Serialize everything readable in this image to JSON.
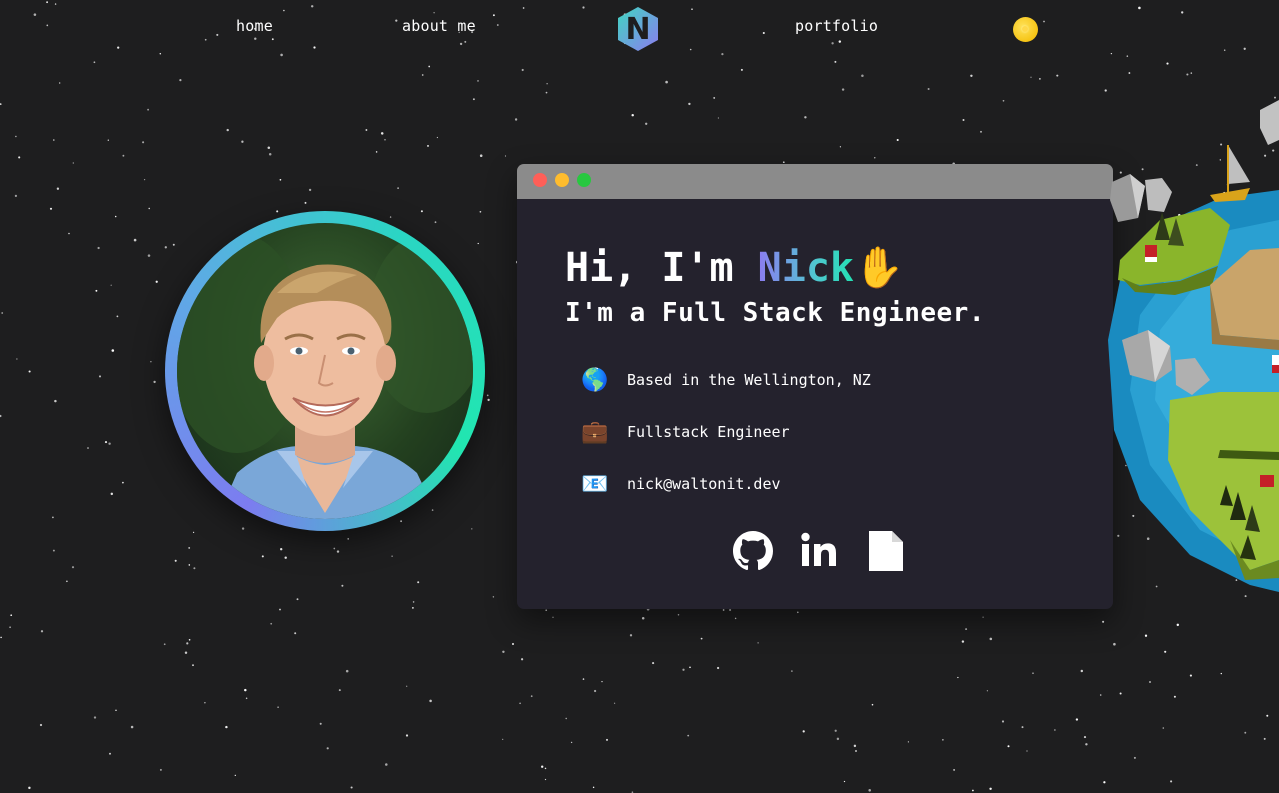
{
  "nav": {
    "home": "home",
    "about": "about me",
    "logo_letter": "N",
    "portfolio": "portfolio",
    "theme_toggle_icon": "sun-icon"
  },
  "hero": {
    "greeting_prefix": "Hi, I'm ",
    "name": "Nick",
    "wave_emoji": "✋",
    "subtitle": "I'm a Full Stack Engineer."
  },
  "info": [
    {
      "icon": "🌎",
      "text": "Based in the Wellington, NZ"
    },
    {
      "icon": "💼",
      "text": "Fullstack Engineer"
    },
    {
      "icon": "📧",
      "text": "nick@waltonit.dev"
    }
  ],
  "social": {
    "github_icon": "github-icon",
    "linkedin_icon": "linkedin-icon",
    "resume_icon": "document-icon"
  },
  "colors": {
    "background": "#1e1e1f",
    "card": "#24222d",
    "card_bar": "#8b8b8b",
    "accent_start": "#8c7cf0",
    "accent_end": "#23e0b3"
  }
}
